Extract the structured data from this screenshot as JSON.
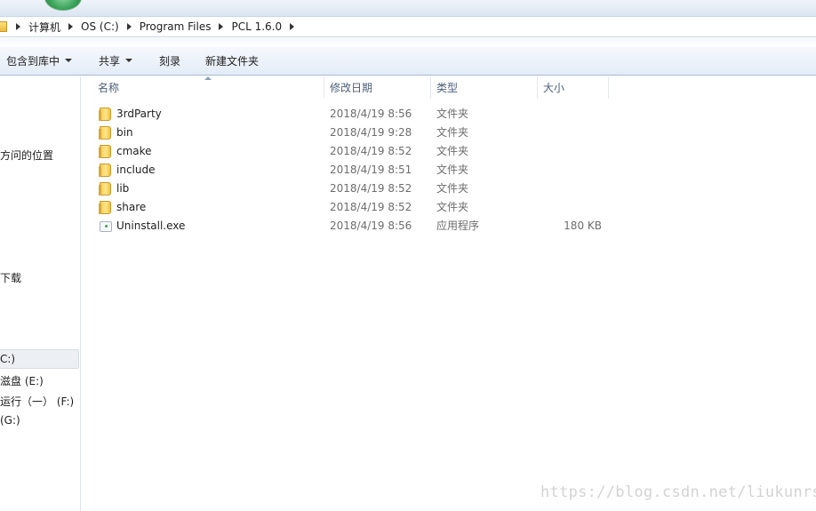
{
  "breadcrumb": [
    "计算机",
    "OS (C:)",
    "Program Files",
    "PCL 1.6.0"
  ],
  "toolbar": {
    "include_in_library": "包含到库中",
    "share": "共享",
    "burn": "刻录",
    "new_folder": "新建文件夹"
  },
  "nav": {
    "recent_places": "方问的位置",
    "downloads": "下载",
    "drive_c": "C:)",
    "drive_e": "滋盘 (E:)",
    "drive_f": "运行（一） (F:)",
    "drive_g": "(G:)"
  },
  "columns": {
    "name": "名称",
    "modified": "修改日期",
    "type": "类型",
    "size": "大小"
  },
  "files": [
    {
      "name": "3rdParty",
      "modified": "2018/4/19 8:56",
      "type": "文件夹",
      "size": "",
      "icon": "folder-icon"
    },
    {
      "name": "bin",
      "modified": "2018/4/19 9:28",
      "type": "文件夹",
      "size": "",
      "icon": "folder-icon"
    },
    {
      "name": "cmake",
      "modified": "2018/4/19 8:52",
      "type": "文件夹",
      "size": "",
      "icon": "folder-icon"
    },
    {
      "name": "include",
      "modified": "2018/4/19 8:51",
      "type": "文件夹",
      "size": "",
      "icon": "folder-icon"
    },
    {
      "name": "lib",
      "modified": "2018/4/19 8:52",
      "type": "文件夹",
      "size": "",
      "icon": "folder-icon"
    },
    {
      "name": "share",
      "modified": "2018/4/19 8:52",
      "type": "文件夹",
      "size": "",
      "icon": "folder-icon"
    },
    {
      "name": "Uninstall.exe",
      "modified": "2018/4/19 8:56",
      "type": "应用程序",
      "size": "180 KB",
      "icon": "application-icon"
    }
  ],
  "watermark": "https://blog.csdn.net/liukunrs"
}
